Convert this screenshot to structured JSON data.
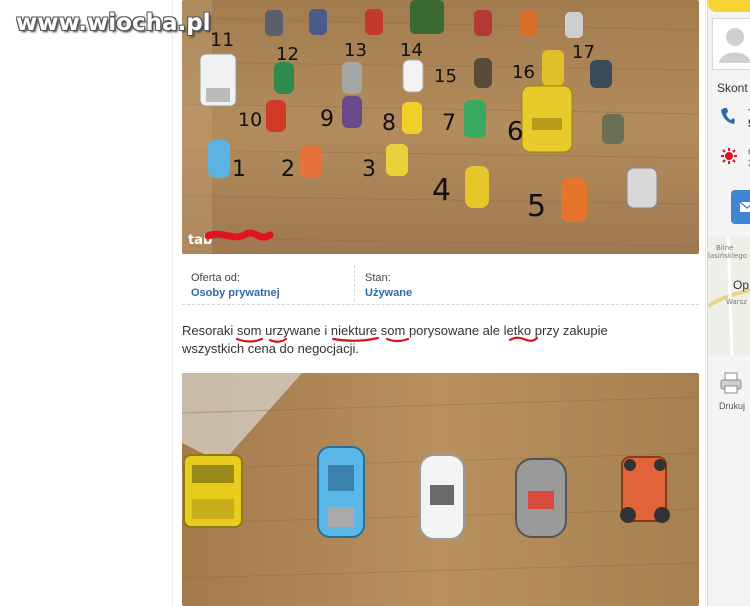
{
  "watermark": "www.wiocha.pl",
  "photo_top": {
    "number_labels": [
      "1",
      "2",
      "3",
      "4",
      "5",
      "6",
      "7",
      "8",
      "9",
      "10",
      "11",
      "12",
      "13",
      "14",
      "15",
      "16",
      "17"
    ],
    "logo_text": "tab"
  },
  "details": {
    "offer_from_label": "Oferta od:",
    "offer_from_value": "Osoby prywatnej",
    "condition_label": "Stan:",
    "condition_value": "Używane"
  },
  "description": {
    "w1": "Resoraki",
    "w2": "som",
    "w3": "urzywane",
    "w4": "i",
    "w5": "niekture",
    "w6": "som",
    "w7": "porysowane ale",
    "w8": "letko",
    "w9": "przy zakupie",
    "line2": "wszystkich cena do negocjacji."
  },
  "sidebar": {
    "contact_label": "Skont",
    "phone_partial_1": "T",
    "phone_partial_2": "5",
    "hours_partial_1": "C",
    "hours_partial_2": "3",
    "map_label": "Op",
    "map_text_1": "Bilne",
    "map_text_2": "lasińskiego",
    "map_text_3": "Warsz",
    "print_label": "Drukuj"
  },
  "colors": {
    "link_blue": "#2e6aa8",
    "underline_red": "#d8141e",
    "floor_wood": "#b08a5c",
    "accent_yellow": "#f4d335",
    "button_blue": "#3f87d6"
  }
}
